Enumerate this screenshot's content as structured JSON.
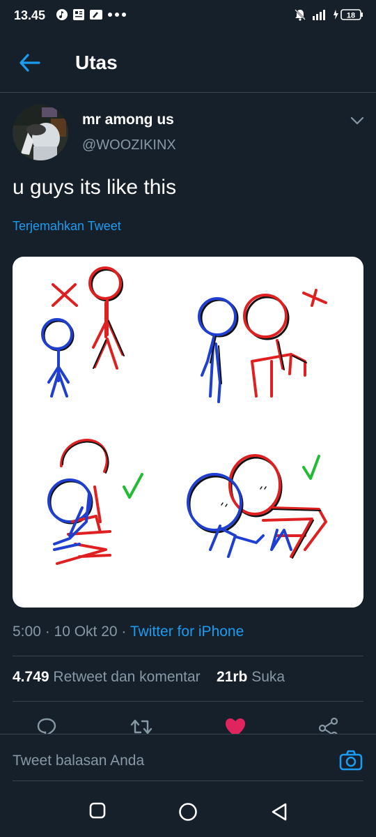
{
  "status": {
    "time": "13.45",
    "battery": "18"
  },
  "header": {
    "title": "Utas"
  },
  "tweet": {
    "name": "mr among us",
    "handle": "@WOOZIKINX",
    "text": "u guys its like this",
    "translate": "Terjemahkan Tweet",
    "time": "5:00 · 10 Okt 20 · ",
    "source": "Twitter for iPhone"
  },
  "stats": {
    "retweets_count": "4.749",
    "retweets_label": " Retweet dan komentar",
    "likes_count": "21rb",
    "likes_label": " Suka"
  },
  "reply": {
    "placeholder": "Tweet balasan Anda"
  },
  "colors": {
    "accent": "#1d9bf0",
    "like": "#e0245e",
    "bg": "#15202b"
  }
}
